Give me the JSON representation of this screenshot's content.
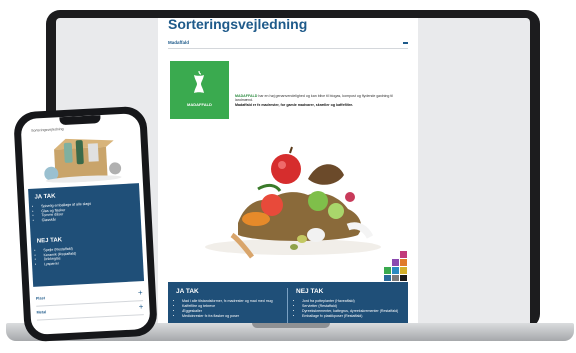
{
  "laptop": {
    "doc_title": "Sorteringsvejledning",
    "section_label": "Madaffald",
    "tile_label": "MADAFFALD",
    "intro_highlight": "MADAFFALD",
    "intro_text": " har en høj genanvendelighed og kan blive til biogas, kompost og flydende gødning til landmænd.",
    "intro_strong": "Madaffald er fx madrester, for gamle madvarer, skræller og kaffefiltre.",
    "ja_tak": {
      "title": "JA TAK",
      "items": [
        "Mad i alle tilstandsformer, fx madrester og mad med mug",
        "Kaffefiltre og tebreve",
        "Æggeskaller",
        "Medicinrester fx fra flasker og poser"
      ]
    },
    "nej_tak": {
      "title": "NEJ TAK",
      "items": [
        "Jord fra potteplanter (Haveaffald)",
        "Servietter (Restaffald)",
        "Dyreekskrementer, kattegrus, dyreekskrementer (Restaffald)",
        "Emballage fx plastikposer (Restaffald)"
      ]
    },
    "colors": {
      "brand_blue": "#1f4f78",
      "brand_green": "#3aaa4f"
    }
  },
  "phone": {
    "title": "Sorteringsvejledning",
    "ja_tak": {
      "title": "JA TAK",
      "items": [
        "Spiselig emballage af alle slags",
        "Glas og flasker",
        "Tomme dåser",
        "Glasskår"
      ]
    },
    "nej_tak": {
      "title": "NEJ TAK",
      "items": [
        "Spejle (Restaffald)",
        "Keramik (Restaffald)",
        "Drikkeglas",
        "Lyspærer"
      ]
    },
    "rows": [
      {
        "label": "Plast"
      },
      {
        "label": "Metal"
      }
    ]
  }
}
